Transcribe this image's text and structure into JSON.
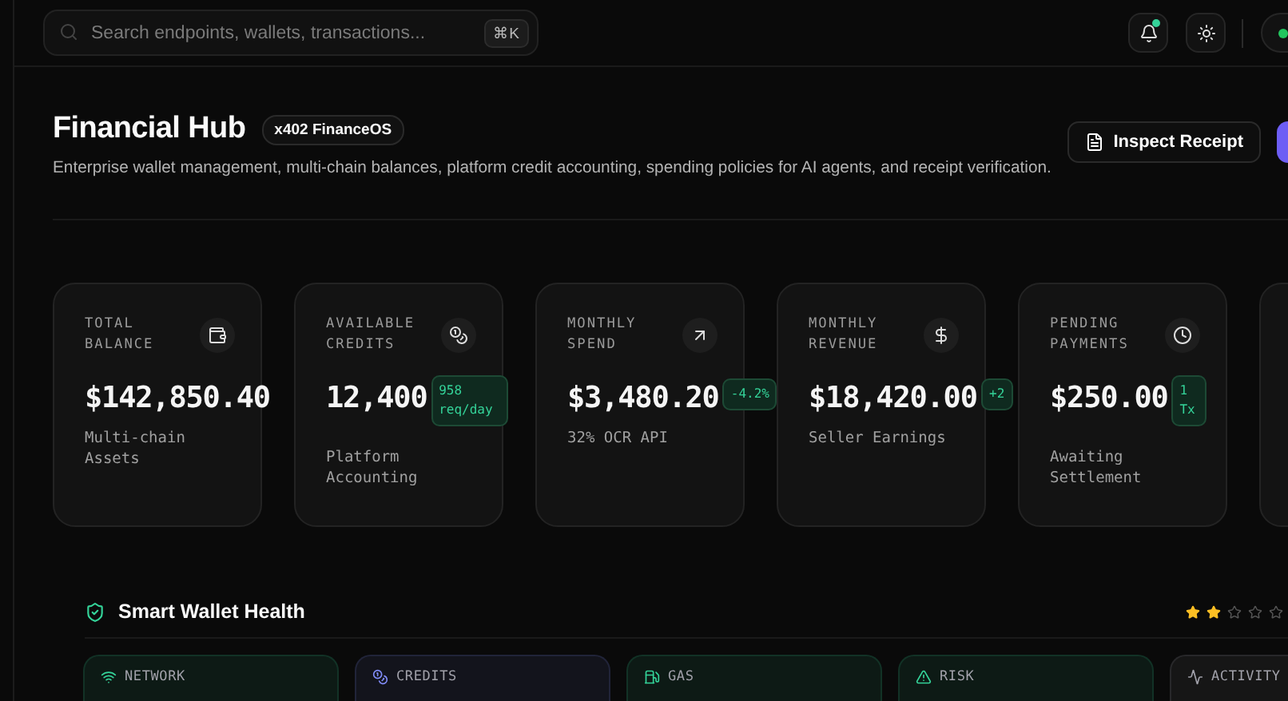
{
  "topbar": {
    "search": {
      "placeholder": "Search endpoints, wallets, transactions...",
      "shortcut": "⌘K"
    },
    "notifications": {
      "unread": true
    }
  },
  "header": {
    "title": "Financial Hub",
    "badge": "x402 FinanceOS",
    "subtitle": "Enterprise wallet management, multi-chain balances, platform credit accounting, spending policies for AI agents, and receipt verification.",
    "actions": [
      {
        "label": "Inspect Receipt"
      }
    ]
  },
  "stats": [
    {
      "label": "TOTAL BALANCE",
      "value": "$142,850.40",
      "note": "Multi-chain Assets"
    },
    {
      "label": "AVAILABLE CREDITS",
      "value": "12,400",
      "badge": "958 req/day",
      "note": "Platform Accounting"
    },
    {
      "label": "MONTHLY SPEND",
      "value": "$3,480.20",
      "badge": "-4.2%",
      "note": "32% OCR API"
    },
    {
      "label": "MONTHLY REVENUE",
      "value": "$18,420.00",
      "badge": "+2",
      "note": "Seller Earnings"
    },
    {
      "label": "PENDING PAYMENTS",
      "value": "$250.00",
      "badge": "1 Tx",
      "note": "Awaiting Settlement"
    }
  ],
  "health": {
    "title": "Smart Wallet Health",
    "stars": 2,
    "tiles": [
      {
        "label": "NETWORK",
        "color": "#34d399"
      },
      {
        "label": "CREDITS",
        "color": "#818cf8"
      },
      {
        "label": "GAS",
        "color": "#34d399"
      },
      {
        "label": "RISK",
        "color": "#34d399"
      },
      {
        "label": "ACTIVITY",
        "color": "#a1a1aa"
      }
    ]
  }
}
